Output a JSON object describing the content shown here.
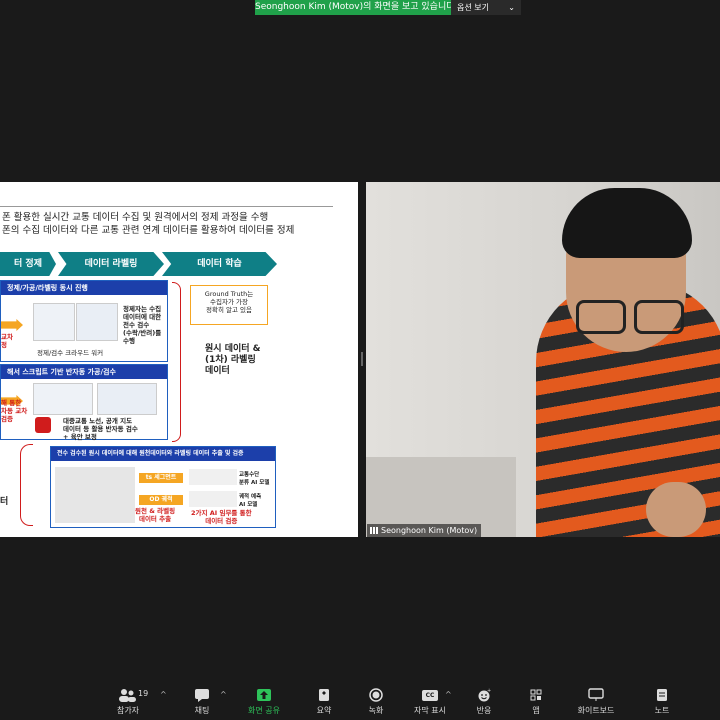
{
  "banner": {
    "text": "Seonghoon Kim (Motov)의 화면을 보고 있습니다",
    "options_label": "옵션 보기",
    "options_caret": "⌄"
  },
  "slide": {
    "line1": "폰 활용한 실시간 교통 데이터 수집 및 원격에서의 정제 과정을 수행",
    "line2": "폰의 수집 데이터와 다른 교통 관련 연계 데이터를 활용하여 데이터를 정제",
    "steps": [
      "터 정제",
      "데이터 라벨링",
      "데이터 학습"
    ],
    "box1_title": "정제/가공/라벨링 동시 진행",
    "box1_caption": "정제/검수 크라우드 워커",
    "box1_desc": "정제자는 수집\n데이터에 대한\n전수 검수\n(수락/반려)를\n수행",
    "box1_left_red": "교차\n정",
    "ground_truth": "Ground Truth는\n수집자가 가장\n정확히 알고 있음",
    "raw_label": "원시 데이터 &\n(1차) 라벨링\n데이터",
    "box2_title": "해서 스크립트 기반 반자동 가공/검수",
    "box2_desc": "대중교통 노선, 공개 지도\n데이터 등 활용 반자동 검수\n+ 육안 보정",
    "box2_left_red": "해 통한\n차동 교차\n검증",
    "box3_title": "전수 검수된 원시 데이터에 대해 원천데이터와 라벨링 데이터 추출 및 검증",
    "ts_label": "ts 세그먼트",
    "od_label": "OD 궤적",
    "extract_label": "원천 & 라벨링\n데이터 추출",
    "ai_label": "2가지 AI 임무를 통한\n데이터 검증",
    "mode_label": "교통수단\n분류 AI 모델",
    "traj_label": "궤적 예측\nAI 모델",
    "left_small": "터"
  },
  "camera": {
    "participant_name": "Seonghoon Kim (Motov)"
  },
  "toolbar": {
    "participant_count": "19",
    "items": [
      {
        "label": "참가자",
        "icon": "participants-icon"
      },
      {
        "label": "채팅",
        "icon": "chat-icon"
      },
      {
        "label": "화면 공유",
        "icon": "share-screen-icon"
      },
      {
        "label": "요약",
        "icon": "summary-icon"
      },
      {
        "label": "녹화",
        "icon": "record-icon"
      },
      {
        "label": "자막 표시",
        "icon": "captions-icon"
      },
      {
        "label": "반응",
        "icon": "reactions-icon"
      },
      {
        "label": "앱",
        "icon": "apps-icon"
      },
      {
        "label": "화이트보드",
        "icon": "whiteboard-icon"
      },
      {
        "label": "노트",
        "icon": "notes-icon"
      }
    ],
    "cc_text": "CC"
  },
  "colors": {
    "accent_green": "#20a14a",
    "teal": "#0f7f86",
    "blue": "#1c3faa",
    "red": "#d01c1c",
    "orange": "#f5a623"
  }
}
